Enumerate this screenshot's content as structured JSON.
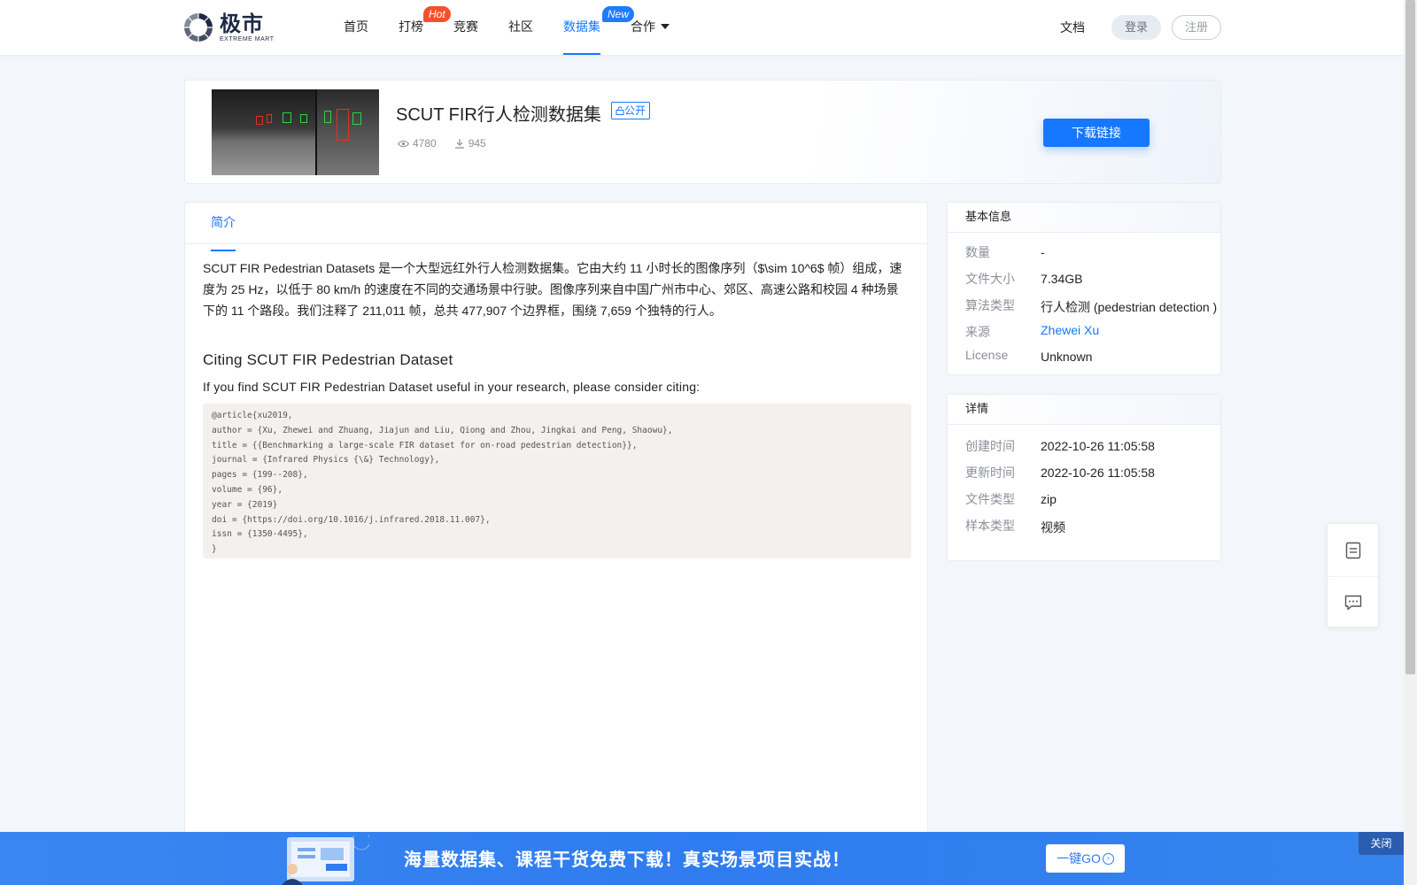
{
  "colors": {
    "accent": "#1677ff",
    "hot_badge": "#f5502e",
    "new_badge": "#1e7bff",
    "banner": "#2f7cf0"
  },
  "header": {
    "logo_cn": "极市",
    "logo_en": "EXTREME MART",
    "nav": [
      {
        "label": "首页"
      },
      {
        "label": "打榜",
        "badge": "Hot"
      },
      {
        "label": "竞赛"
      },
      {
        "label": "社区"
      },
      {
        "label": "数据集",
        "badge": "New",
        "active": true
      },
      {
        "label": "合作"
      }
    ],
    "docs": "文档",
    "login": "登录",
    "register": "注册"
  },
  "dataset": {
    "title": "SCUT FIR行人检测数据集",
    "visibility": "公开",
    "views": "4780",
    "downloads": "945",
    "download_button": "下载链接"
  },
  "main": {
    "tab": "简介",
    "intro": "SCUT FIR Pedestrian Datasets 是一个大型远红外行人检测数据集。它由大约 11 小时长的图像序列（$\\sim 10^6$ 帧）组成，速度为 25 Hz，以低于 80 km/h 的速度在不同的交通场景中行驶。图像序列来自中国广州市中心、郊区、高速公路和校园 4 种场景下的 11 个路段。我们注释了 211,011 帧，总共 477,907 个边界框，围绕 7,659 个独特的行人。",
    "citing_heading": "Citing SCUT FIR Pedestrian Dataset",
    "citing_text": "If you find SCUT FIR Pedestrian Dataset useful in your research, please consider citing:",
    "bibtex": "@article{xu2019,\nauthor = {Xu, Zhewei and Zhuang, Jiajun and Liu, Qiong and Zhou, Jingkai and Peng, Shaowu},\ntitle = {{Benchmarking a large-scale FIR dataset for on-road pedestrian detection}},\njournal = {Infrared Physics {\\&} Technology},\npages = {199--208},\nvolume = {96},\nyear = {2019}\ndoi = {https://doi.org/10.1016/j.infrared.2018.11.007},\nissn = {1350-4495},\n}"
  },
  "basic_info": {
    "heading": "基本信息",
    "rows": [
      {
        "key": "数量",
        "value": "-"
      },
      {
        "key": "文件大小",
        "value": "7.34GB"
      },
      {
        "key": "算法类型",
        "value": "行人检测 (pedestrian detection )"
      },
      {
        "key": "来源",
        "value": "Zhewei Xu"
      },
      {
        "key": "License",
        "value": "Unknown"
      }
    ]
  },
  "details": {
    "heading": "详情",
    "rows": [
      {
        "key": "创建时间",
        "value": "2022-10-26 11:05:58"
      },
      {
        "key": "更新时间",
        "value": "2022-10-26 11:05:58"
      },
      {
        "key": "文件类型",
        "value": "zip"
      },
      {
        "key": "样本类型",
        "value": "视频"
      }
    ]
  },
  "banner": {
    "text": "海量数据集、课程干货免费下载！真实场景项目实战！",
    "go": "一键GO",
    "close": "关闭"
  }
}
